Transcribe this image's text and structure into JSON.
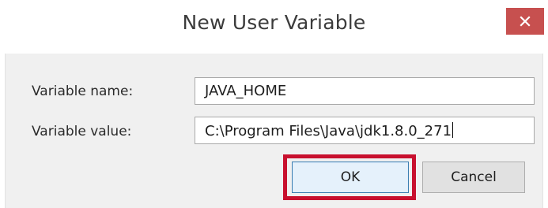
{
  "dialog": {
    "title": "New User Variable",
    "close_icon": "close-icon",
    "close_color": "#c7504f"
  },
  "form": {
    "name_label": "Variable name:",
    "name_value": "JAVA_HOME",
    "value_label": "Variable value:",
    "value_value": "C:\\Program Files\\Java\\jdk1.8.0_271"
  },
  "buttons": {
    "ok_label": "OK",
    "cancel_label": "Cancel"
  },
  "annotation": {
    "highlight_color": "#c8102e"
  }
}
